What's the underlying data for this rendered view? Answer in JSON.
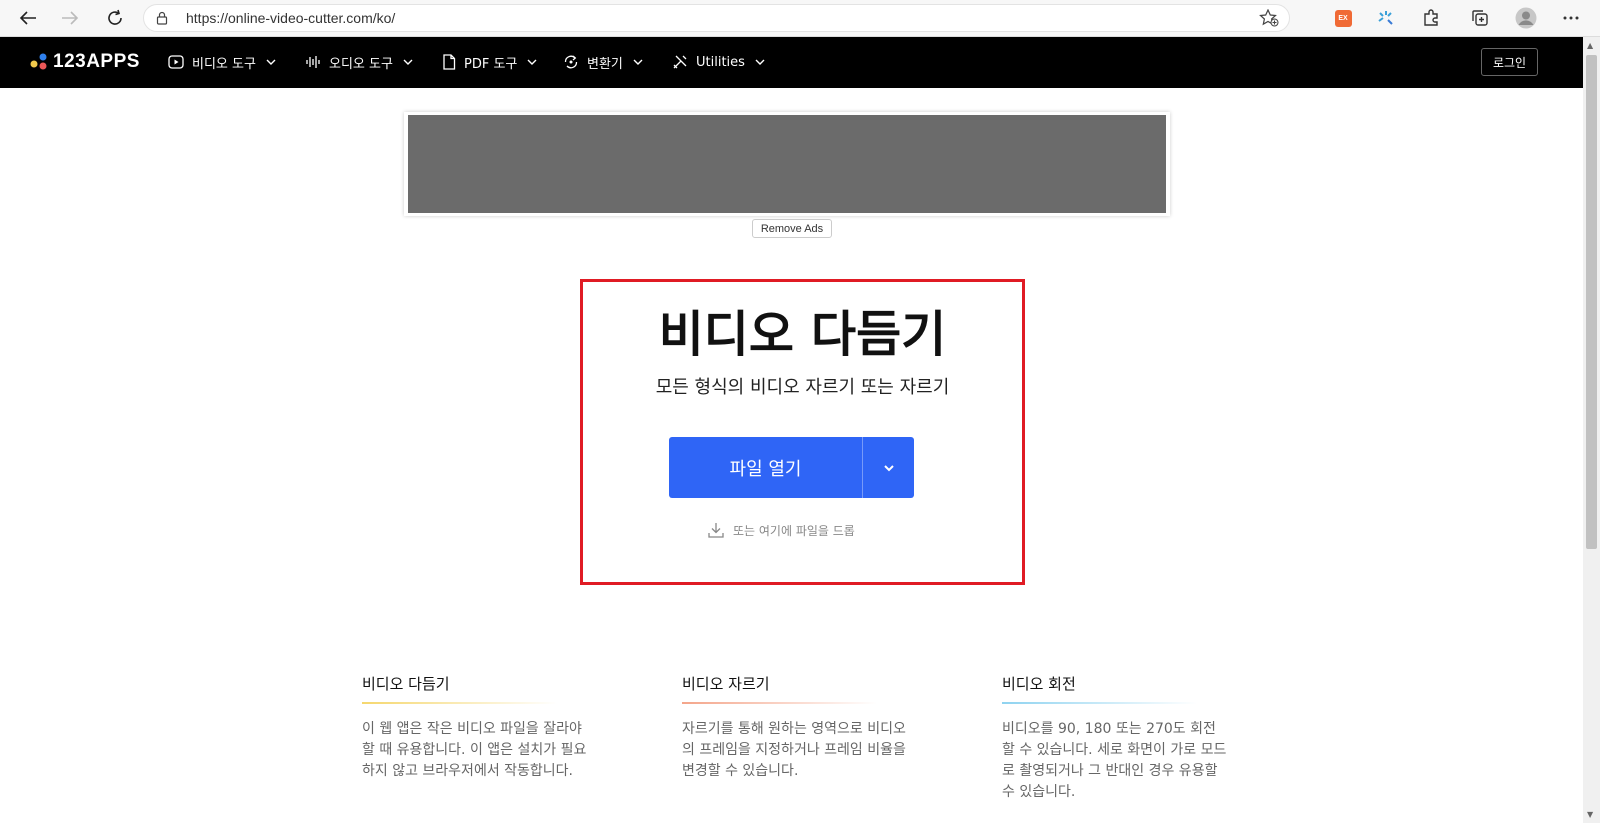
{
  "browser": {
    "url": "https://online-video-cutter.com/ko/",
    "ext_badge": "EX"
  },
  "header": {
    "logo": "123APPS",
    "menu": [
      {
        "label": "비디오 도구"
      },
      {
        "label": "오디오 도구"
      },
      {
        "label": "PDF 도구"
      },
      {
        "label": "변환기"
      },
      {
        "label": "Utilities"
      }
    ],
    "login": "로그인"
  },
  "ad": {
    "remove_label": "Remove Ads"
  },
  "hero": {
    "title": "비디오 다듬기",
    "subtitle": "모든 형식의 비디오 자르기 또는 자르기",
    "open_button": "파일 열기",
    "drop_hint": "또는 여기에 파일을 드롭"
  },
  "features": [
    {
      "title": "비디오 다듬기",
      "text": "이 웹 앱은 작은 비디오 파일을 잘라야 할 때 유용합니다. 이 앱은 설치가 필요하지 않고 브라우저에서 작동합니다.",
      "accent": "#f5d76e"
    },
    {
      "title": "비디오 자르기",
      "text": "자르기를 통해 원하는 영역으로 비디오의 프레임을 지정하거나 프레임 비율을 변경할 수 있습니다.",
      "accent": "#f4a58a"
    },
    {
      "title": "비디오 회전",
      "text": "비디오를 90, 180 또는 270도 회전할 수 있습니다. 세로 화면이 가로 모드로 촬영되거나 그 반대인 경우 유용할 수 있습니다.",
      "accent": "#8fd3f0"
    }
  ],
  "colors": {
    "primary_button": "#2f65f6",
    "highlight_frame": "#e01b24",
    "header_bg": "#000000"
  }
}
